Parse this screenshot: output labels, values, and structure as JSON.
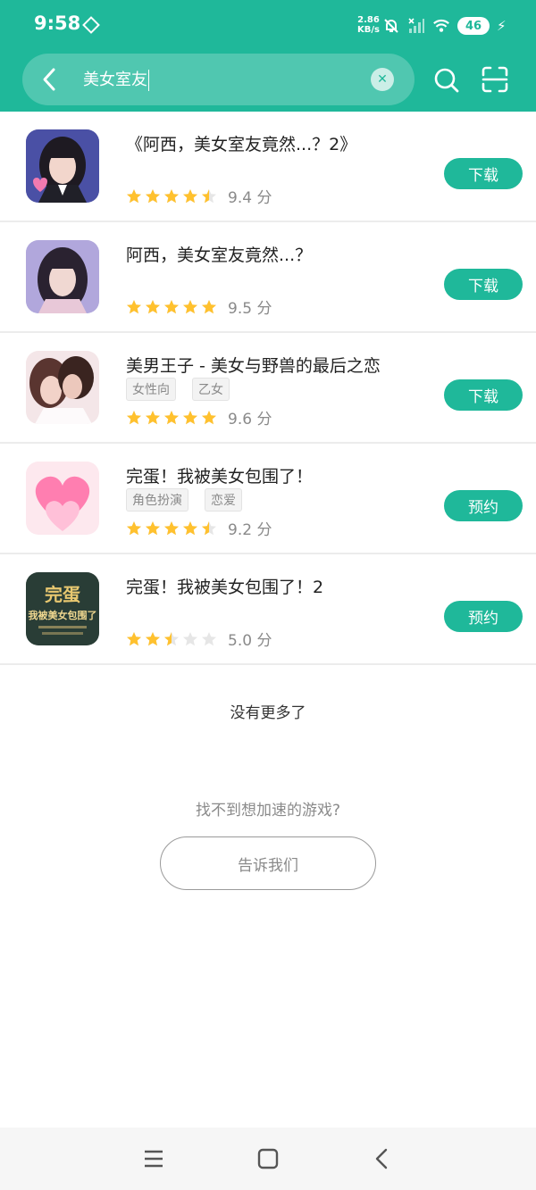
{
  "status_bar": {
    "time": "9:58",
    "speed": "2.86",
    "speed_unit": "KB/s",
    "battery": "46"
  },
  "search": {
    "query": "美女室友"
  },
  "results": [
    {
      "title": "《阿西，美女室友竟然...？2》",
      "tags": [],
      "score": "9.4 分",
      "rating": 4.5,
      "button": "下载"
    },
    {
      "title": "阿西，美女室友竟然...？",
      "tags": [],
      "score": "9.5 分",
      "rating": 5,
      "button": "下载"
    },
    {
      "title": "美男王子 - 美女与野兽的最后之恋",
      "tags": [
        "女性向",
        "乙女"
      ],
      "score": "9.6 分",
      "rating": 5,
      "button": "下载"
    },
    {
      "title": "完蛋！我被美女包围了！",
      "tags": [
        "角色扮演",
        "恋爱"
      ],
      "score": "9.2 分",
      "rating": 4.5,
      "button": "预约"
    },
    {
      "title": "完蛋！我被美女包围了！2",
      "tags": [],
      "score": "5.0 分",
      "rating": 2.5,
      "button": "预约"
    }
  ],
  "icon_art": {
    "text_line_1": "完蛋",
    "text_line_2": "我被美女包围了"
  },
  "footer": {
    "no_more": "没有更多了",
    "not_found": "找不到想加速的游戏?",
    "tell_us": "告诉我们"
  },
  "colors": {
    "accent": "#1fb89a",
    "star": "#ffc12e",
    "star_empty": "#e6e6e6"
  }
}
